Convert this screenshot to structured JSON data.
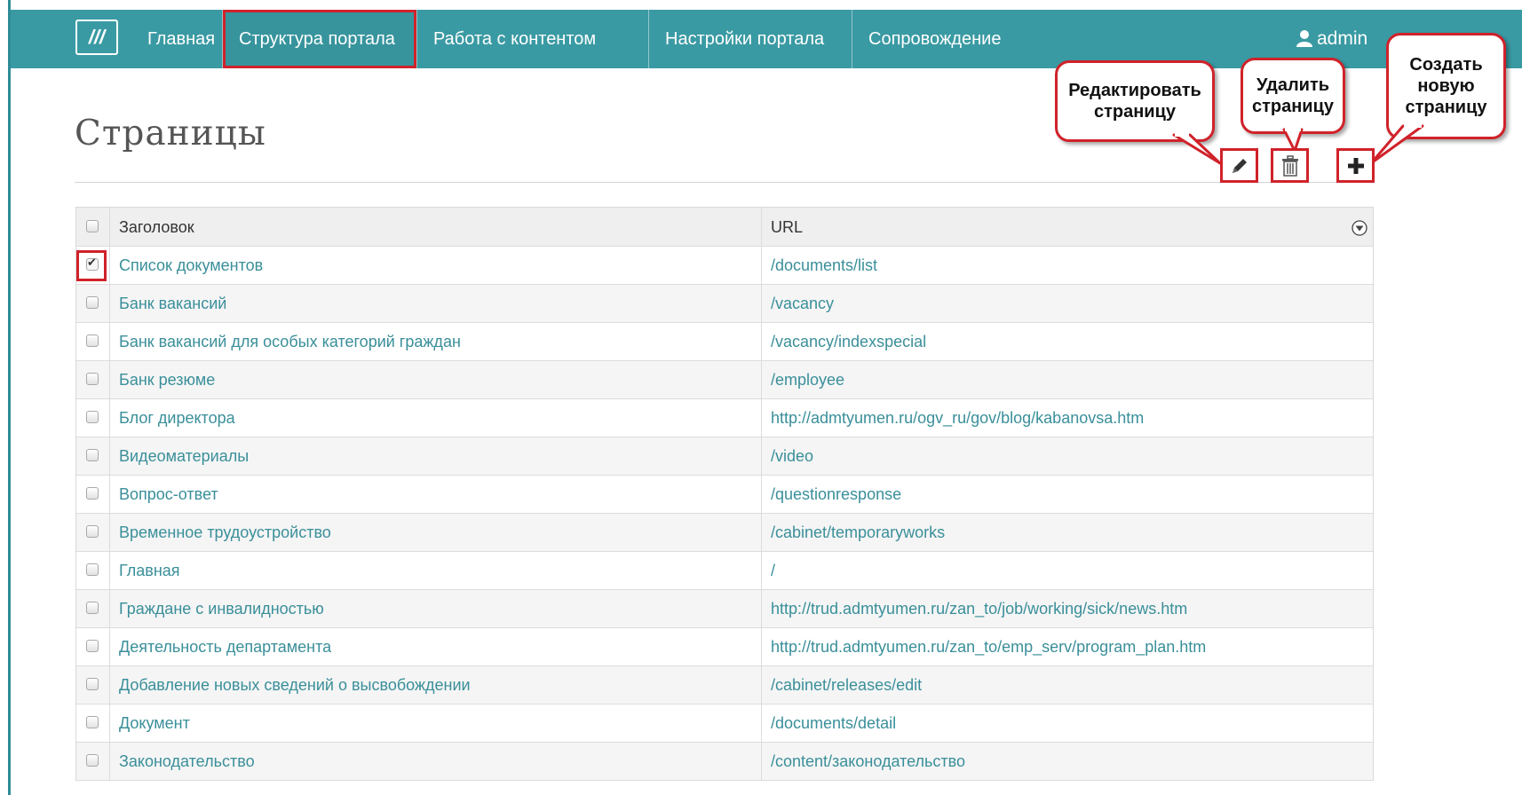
{
  "nav": {
    "logo_text": "///",
    "items": [
      {
        "label": "Главная"
      },
      {
        "label": "Структура портала"
      },
      {
        "label": "Работа с контентом"
      },
      {
        "label": "Настройки портала"
      },
      {
        "label": "Сопровождение"
      }
    ],
    "active_index": 1,
    "user": "admin"
  },
  "page": {
    "title": "Страницы"
  },
  "toolbar": {
    "edit_icon": "pencil-icon",
    "delete_icon": "trash-icon",
    "create_icon": "plus-icon"
  },
  "callouts": {
    "edit": "Редактировать\nстраницу",
    "delete": "Удалить\nстраницу",
    "create": "Создать\nновую\nстраницу"
  },
  "table": {
    "columns": [
      "Заголовок",
      "URL"
    ],
    "filter_icon": "filter-icon",
    "rows": [
      {
        "title": "Список документов",
        "url": "/documents/list",
        "checked": true
      },
      {
        "title": "Банк вакансий",
        "url": "/vacancy",
        "checked": false
      },
      {
        "title": "Банк вакансий для особых категорий граждан",
        "url": "/vacancy/indexspecial",
        "checked": false
      },
      {
        "title": "Банк резюме",
        "url": "/employee",
        "checked": false
      },
      {
        "title": "Блог директора",
        "url": "http://admtyumen.ru/ogv_ru/gov/blog/kabanovsa.htm",
        "checked": false
      },
      {
        "title": "Видеоматериалы",
        "url": "/video",
        "checked": false
      },
      {
        "title": "Вопрос-ответ",
        "url": "/questionresponse",
        "checked": false
      },
      {
        "title": "Временное трудоустройство",
        "url": "/cabinet/temporaryworks",
        "checked": false
      },
      {
        "title": "Главная",
        "url": "/",
        "checked": false
      },
      {
        "title": "Граждане с инвалидностью",
        "url": "http://trud.admtyumen.ru/zan_to/job/working/sick/news.htm",
        "checked": false
      },
      {
        "title": "Деятельность департамента",
        "url": "http://trud.admtyumen.ru/zan_to/emp_serv/program_plan.htm",
        "checked": false
      },
      {
        "title": "Добавление новых сведений о высвобождении",
        "url": "/cabinet/releases/edit",
        "checked": false
      },
      {
        "title": "Документ",
        "url": "/documents/detail",
        "checked": false
      },
      {
        "title": "Законодательство",
        "url": "/content/законодательство",
        "checked": false
      }
    ]
  },
  "colors": {
    "navbar": "#3a9aa3",
    "link": "#3a8f9a",
    "highlight": "#d0222a"
  }
}
